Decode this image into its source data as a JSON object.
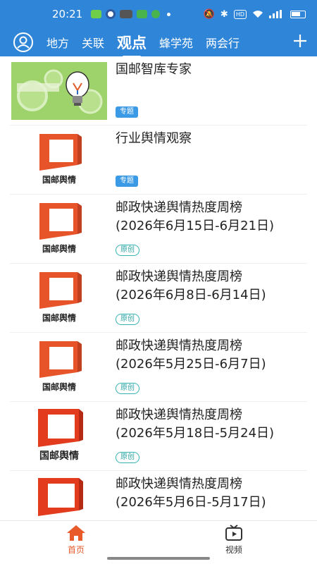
{
  "statusbar": {
    "time": "20:21",
    "hd": "HD"
  },
  "tabs": [
    "地方",
    "关联",
    "观点",
    "蜂学苑",
    "两会行"
  ],
  "active_tab_index": 2,
  "colors": {
    "header": "#2f86d8",
    "accent": "#e85a2a",
    "tag_topic": "#3a9ae6",
    "tag_original": "#35b3b3"
  },
  "feed": [
    {
      "title": "国邮智库专家",
      "tag": "专题",
      "tag_type": "topic",
      "thumb": "lightbulb-gears-image"
    },
    {
      "title": "行业舆情观察",
      "tag": "专题",
      "tag_type": "topic",
      "thumb": "guoyou-yuqing-logo",
      "logo_text": "国邮舆情"
    },
    {
      "title": "邮政快递舆情热度周榜",
      "subtitle": "(2026年6月15日-6月21日)",
      "tag": "原创",
      "tag_type": "original",
      "logo_text": "国邮舆情"
    },
    {
      "title": "邮政快递舆情热度周榜",
      "subtitle": "(2026年6月8日-6月14日)",
      "tag": "原创",
      "tag_type": "original",
      "logo_text": "国邮舆情"
    },
    {
      "title": "邮政快递舆情热度周榜",
      "subtitle": "(2026年5月25日-6月7日)",
      "tag": "原创",
      "tag_type": "original",
      "logo_text": "国邮舆情"
    },
    {
      "title": "邮政快递舆情热度周榜",
      "subtitle": "(2026年5月18日-5月24日)",
      "tag": "原创",
      "tag_type": "original",
      "logo_text": "国邮舆情"
    },
    {
      "title": "邮政快递舆情热度周榜",
      "subtitle": "(2026年5月6日-5月17日)",
      "tag": "",
      "tag_type": "none",
      "logo_text": ""
    }
  ],
  "bottom_nav": {
    "home": "首页",
    "video": "视频"
  }
}
